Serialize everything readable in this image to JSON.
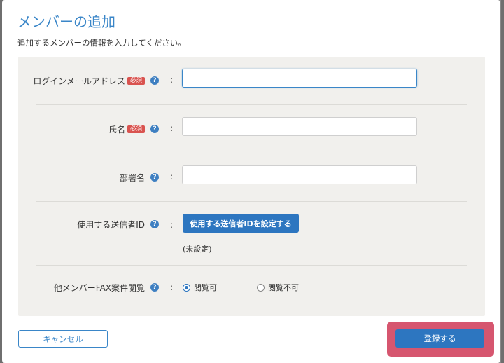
{
  "dialog": {
    "title": "メンバーの追加",
    "description": "追加するメンバーの情報を入力してください。"
  },
  "fields": {
    "login_email": {
      "label": "ログインメールアドレス",
      "required_badge": "必須",
      "value": ""
    },
    "full_name": {
      "label": "氏名",
      "required_badge": "必須",
      "value": ""
    },
    "department": {
      "label": "部署名",
      "value": ""
    },
    "sender_id": {
      "label": "使用する送信者ID",
      "button_label": "使用する送信者IDを設定する",
      "status": "(未設定)"
    },
    "fax_view": {
      "label": "他メンバーFAX案件閲覧",
      "options": [
        "閲覧可",
        "閲覧不可"
      ],
      "selected": "閲覧可"
    }
  },
  "help_glyph": "?",
  "colon": ":",
  "footer": {
    "cancel_label": "キャンセル",
    "submit_label": "登録する"
  },
  "colors": {
    "accent": "#2d76c0",
    "title": "#3a86c8",
    "required": "#d9534f",
    "highlight": "#d6566f",
    "panel": "#f1f0ed"
  }
}
